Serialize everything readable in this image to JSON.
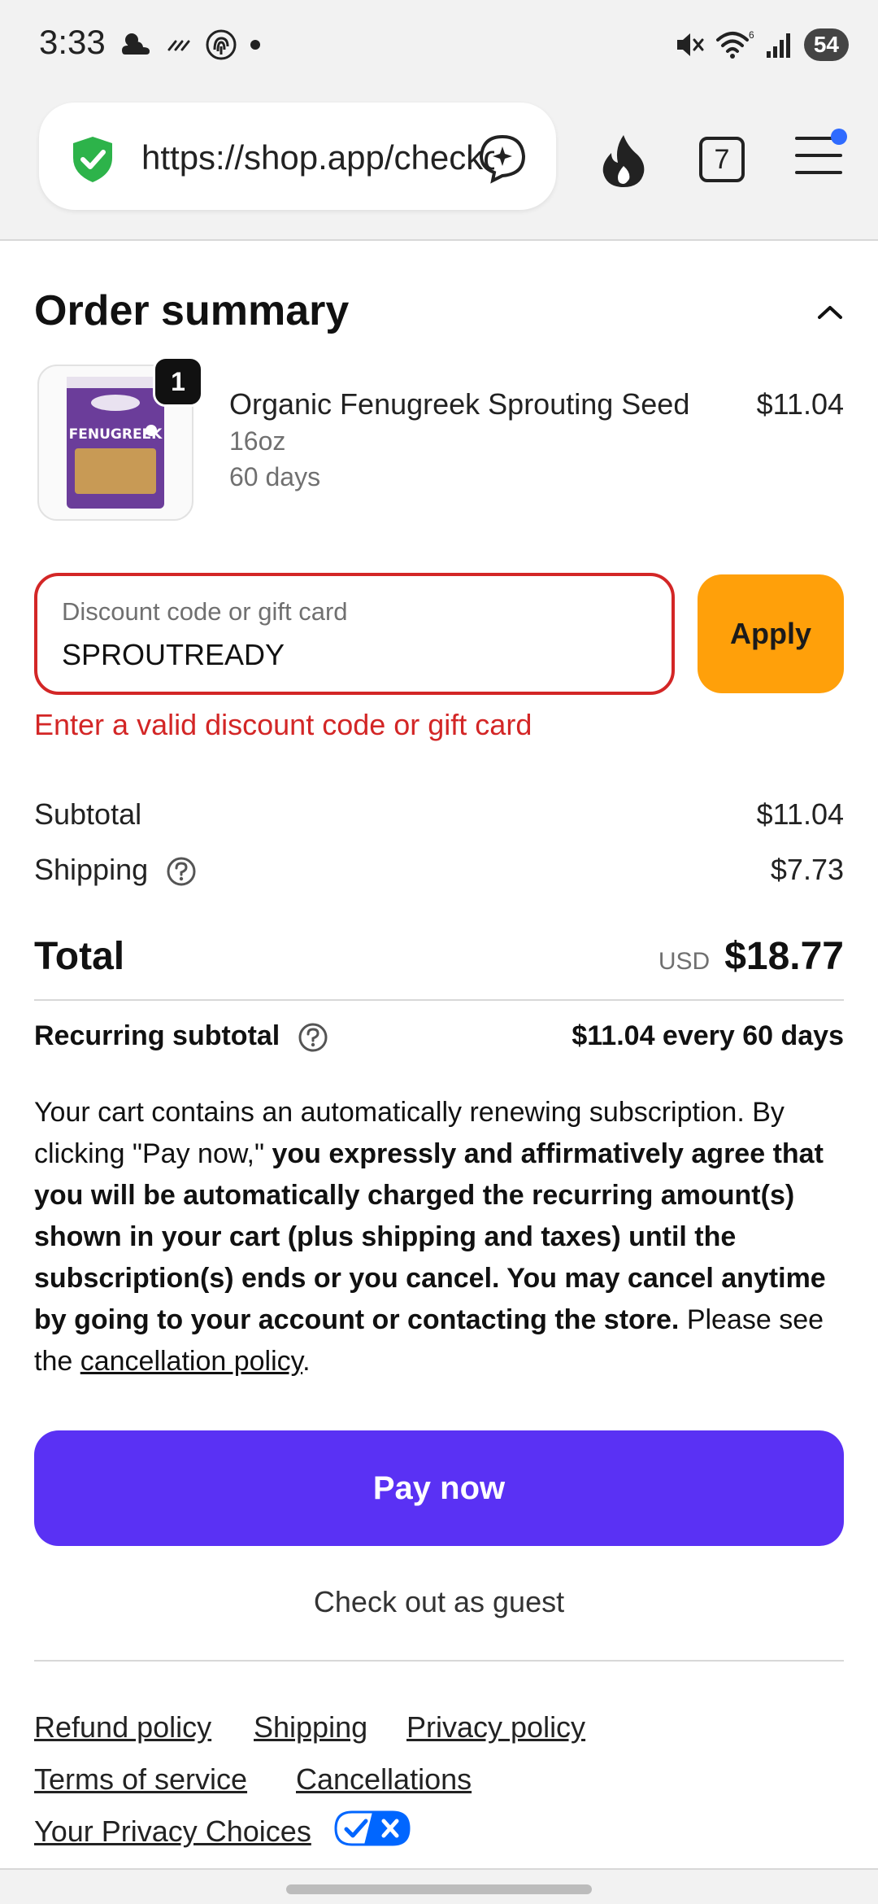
{
  "status_bar": {
    "time": "3:33",
    "battery": "54",
    "icons_left": [
      "cloud-icon",
      "haze-icon",
      "fingerprint-icon",
      "dot-icon"
    ],
    "icons_right": [
      "mute-icon",
      "wifi-icon",
      "signal-icon",
      "battery-icon"
    ]
  },
  "browser": {
    "url": "https://shop.app/checkout",
    "tab_count": "7",
    "colors": {
      "shield": "#2db34a",
      "notification_dot": "#2f6bff"
    }
  },
  "order_summary": {
    "title": "Order summary",
    "item": {
      "quantity": "1",
      "name": "Organic Fenugreek Sprouting Seed",
      "size": "16oz",
      "frequency": "60 days",
      "price": "$11.04",
      "image_label": "FENUGREEK"
    }
  },
  "discount": {
    "placeholder": "Discount code or gift card",
    "value": "SPROUTREADY",
    "apply_label": "Apply",
    "error": "Enter a valid discount code or gift card"
  },
  "totals": {
    "subtotal_label": "Subtotal",
    "subtotal_value": "$11.04",
    "shipping_label": "Shipping",
    "shipping_value": "$7.73",
    "total_label": "Total",
    "currency": "USD",
    "total_value": "$18.77",
    "recurring_label": "Recurring subtotal",
    "recurring_value": "$11.04 every 60 days"
  },
  "legal": {
    "intro": "Your cart contains an automatically renewing subscription. By clicking \"Pay now,\" ",
    "bold": "you expressly and affirmatively agree that you will be automatically charged the recurring amount(s) shown in your cart (plus shipping and taxes) until the subscription(s) ends or you cancel. You may cancel anytime by going to your account or contacting the store.",
    "outro": " Please see the ",
    "link": "cancellation policy",
    "end": "."
  },
  "actions": {
    "pay_now": "Pay now",
    "guest": "Check out as guest"
  },
  "footer": {
    "refund_policy": "Refund policy",
    "shipping": "Shipping",
    "privacy_policy": "Privacy policy",
    "terms": "Terms of service",
    "cancellations": "Cancellations",
    "privacy_choices": "Your Privacy Choices"
  },
  "colors": {
    "error": "#d32626",
    "apply": "#ffa00a",
    "pay": "#5a31f4",
    "privacy_toggle": "#0066ff"
  }
}
